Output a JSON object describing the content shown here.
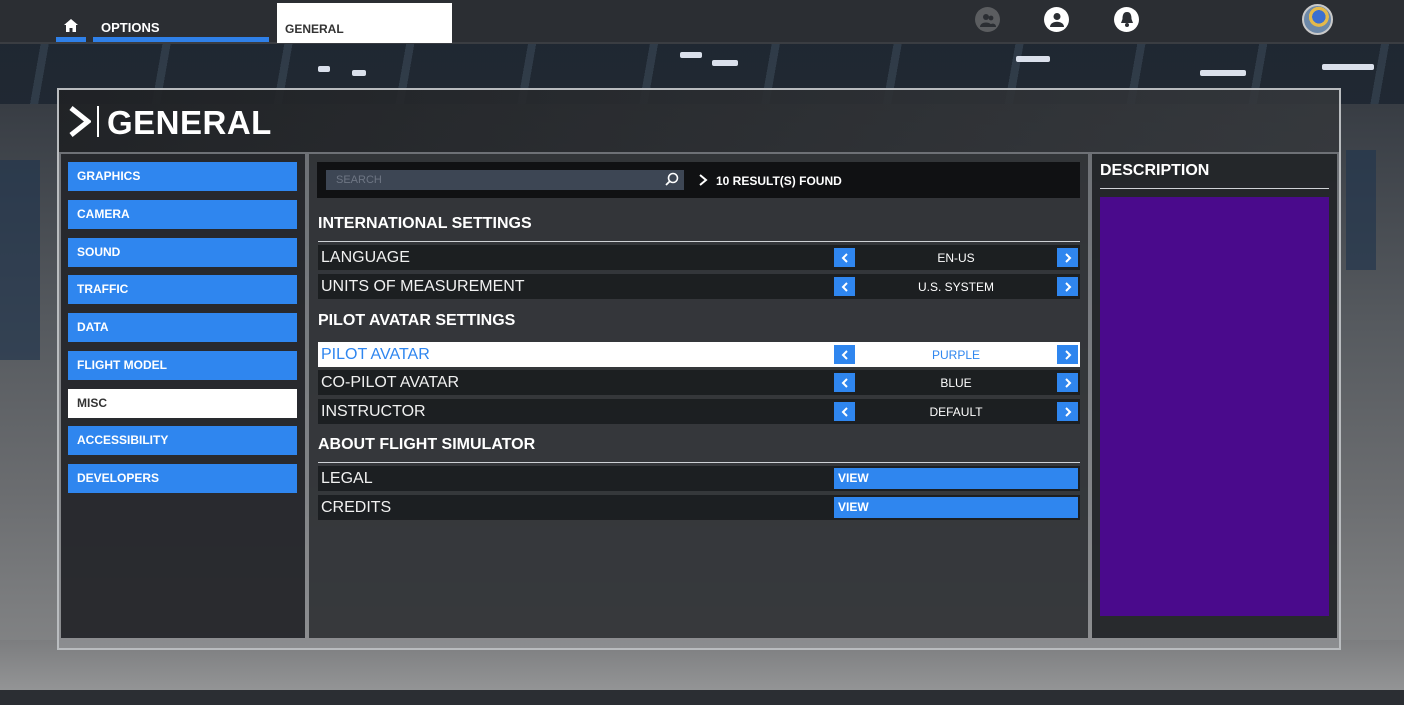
{
  "topbar": {
    "options_label": "OPTIONS",
    "tab_label": "GENERAL",
    "icons": [
      "home-icon",
      "friends-icon",
      "profile-icon",
      "notifications-icon",
      "avatar"
    ]
  },
  "header": {
    "title": "GENERAL"
  },
  "nav": {
    "items": [
      {
        "label": "GRAPHICS",
        "active": false
      },
      {
        "label": "CAMERA",
        "active": false
      },
      {
        "label": "SOUND",
        "active": false
      },
      {
        "label": "TRAFFIC",
        "active": false
      },
      {
        "label": "DATA",
        "active": false
      },
      {
        "label": "FLIGHT MODEL",
        "active": false
      },
      {
        "label": "MISC",
        "active": true
      },
      {
        "label": "ACCESSIBILITY",
        "active": false
      },
      {
        "label": "DEVELOPERS",
        "active": false
      }
    ]
  },
  "search": {
    "placeholder": "SEARCH",
    "results": "10 RESULT(S) FOUND"
  },
  "sections": {
    "international": {
      "title": "INTERNATIONAL SETTINGS",
      "rows": [
        {
          "label": "LANGUAGE",
          "value": "EN-US"
        },
        {
          "label": "UNITS OF MEASUREMENT",
          "value": "U.S. SYSTEM"
        }
      ]
    },
    "pilot_avatar": {
      "title": "PILOT AVATAR SETTINGS",
      "rows": [
        {
          "label": "PILOT AVATAR",
          "value": "PURPLE",
          "highlighted": true
        },
        {
          "label": "CO-PILOT AVATAR",
          "value": "BLUE"
        },
        {
          "label": "INSTRUCTOR",
          "value": "DEFAULT"
        }
      ]
    },
    "about": {
      "title": "ABOUT FLIGHT SIMULATOR",
      "rows": [
        {
          "label": "LEGAL",
          "button": "VIEW"
        },
        {
          "label": "CREDITS",
          "button": "VIEW"
        }
      ]
    }
  },
  "description": {
    "title": "DESCRIPTION",
    "swatch_color": "#4a0a8c"
  },
  "colors": {
    "accent": "#2f86ef",
    "highlight_bg": "#ffffff",
    "avatar_purple": "#4a0a8c"
  }
}
